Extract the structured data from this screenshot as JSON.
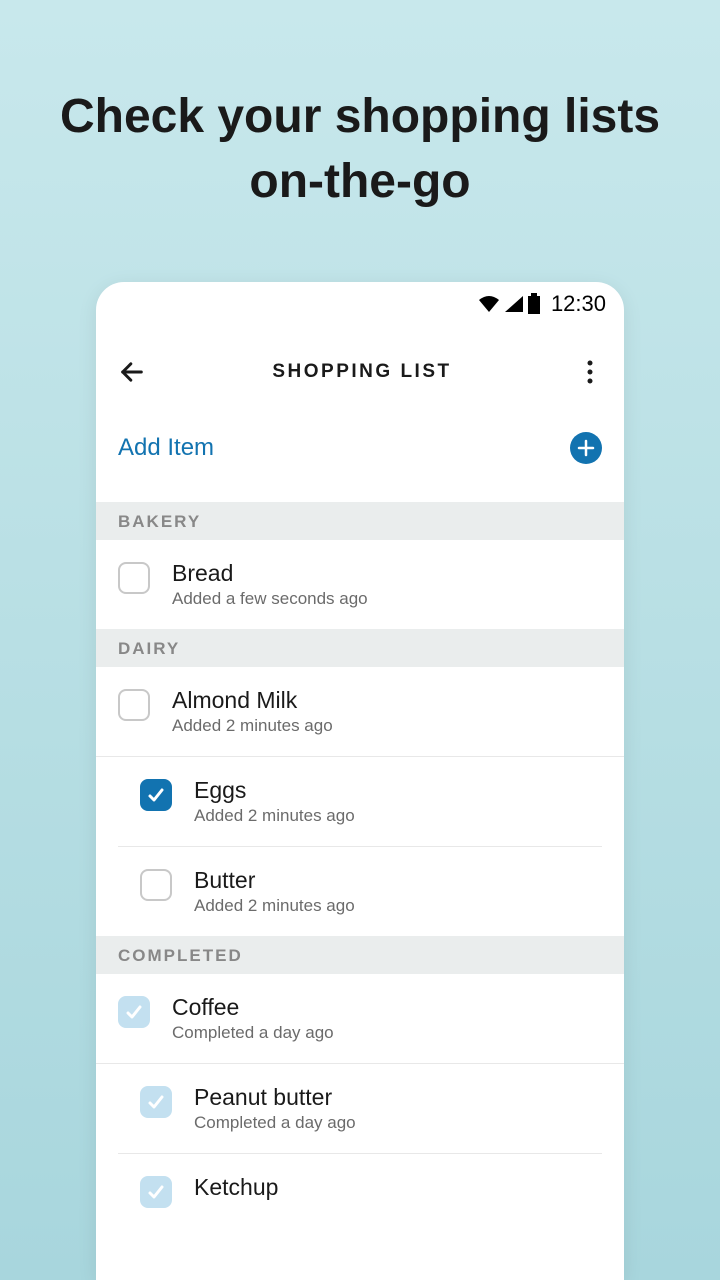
{
  "promo": {
    "headline": "Check your shopping lists on-the-go"
  },
  "status_bar": {
    "time": "12:30"
  },
  "nav": {
    "title": "SHOPPING LIST"
  },
  "add_item": {
    "label": "Add Item"
  },
  "sections": {
    "bakery": {
      "header": "BAKERY",
      "items": [
        {
          "name": "Bread",
          "meta": "Added a few seconds ago",
          "checked": false
        }
      ]
    },
    "dairy": {
      "header": "DAIRY",
      "items": [
        {
          "name": "Almond Milk",
          "meta": "Added 2 minutes ago",
          "checked": false
        },
        {
          "name": "Eggs",
          "meta": "Added 2 minutes ago",
          "checked": true
        },
        {
          "name": "Butter",
          "meta": "Added 2 minutes ago",
          "checked": false
        }
      ]
    },
    "completed": {
      "header": "COMPLETED",
      "items": [
        {
          "name": "Coffee",
          "meta": "Completed a day ago"
        },
        {
          "name": "Peanut butter",
          "meta": "Completed a day ago"
        },
        {
          "name": "Ketchup",
          "meta": ""
        }
      ]
    }
  }
}
